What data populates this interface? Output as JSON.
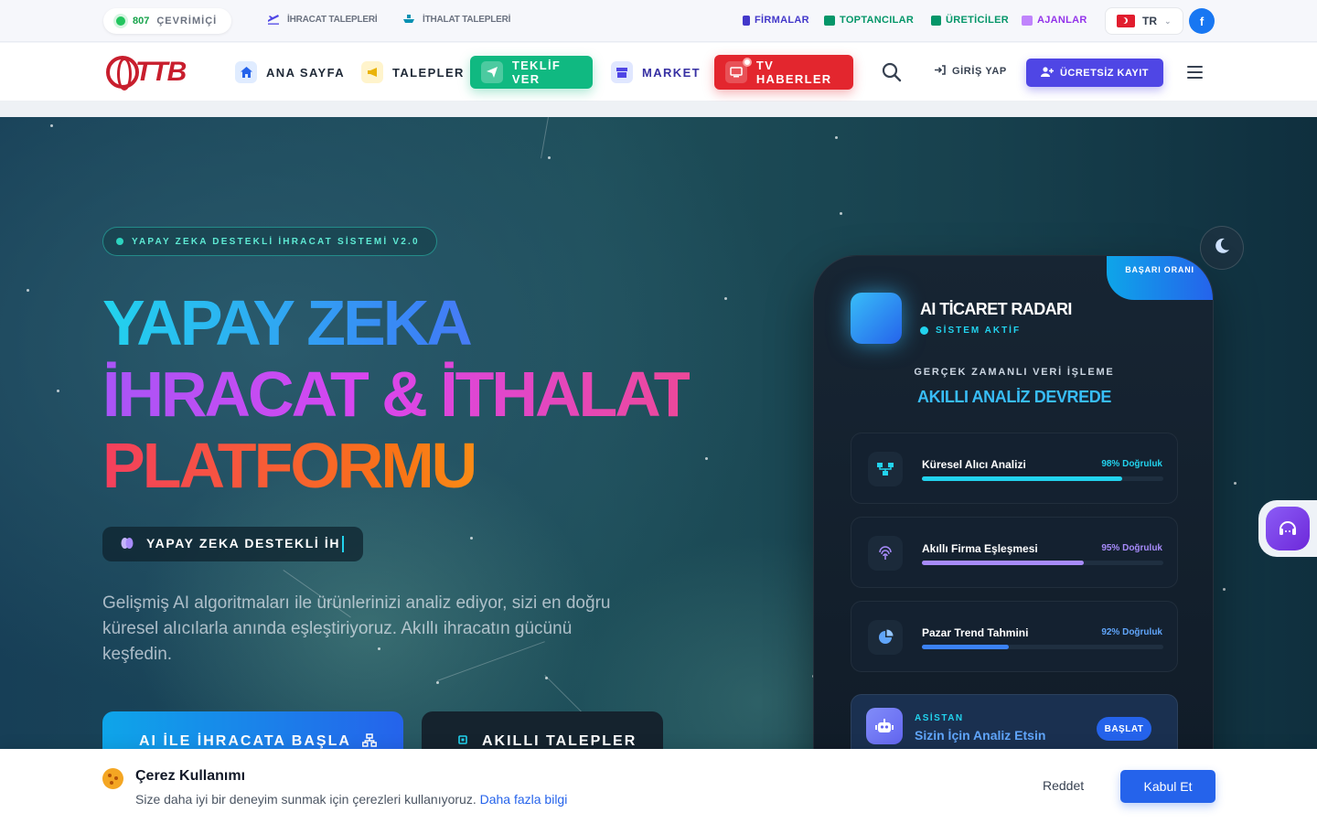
{
  "topbar": {
    "online_count": "807",
    "online_label": "ÇEVRİMİÇİ",
    "export_link": "İHRACAT TALEPLERİ",
    "import_link": "İTHALAT TALEPLERİ",
    "categories": [
      {
        "label": "FİRMALAR",
        "color": "#4338ca"
      },
      {
        "label": "TOPTANCILAR",
        "color": "#059669"
      },
      {
        "label": "ÜRETİCİLER",
        "color": "#059669"
      },
      {
        "label": "AJANLAR",
        "color": "#9333ea"
      }
    ],
    "language": "TR",
    "facebook_glyph": "f"
  },
  "nav": {
    "logo_text": "TTB",
    "home": "ANA SAYFA",
    "requests": "TALEPLER",
    "offer": "TEKLİF VER",
    "market": "MARKET",
    "tv": "TV HABERLER",
    "login": "GİRİŞ YAP",
    "register": "ÜCRETSİZ KAYIT"
  },
  "hero": {
    "badge": "YAPAY ZEKA DESTEKLİ İHRACAT SİSTEMİ V2.0",
    "title_line1": "YAPAY ZEKA",
    "title_line2": "İHRACAT & İTHALAT",
    "title_line3": "PLATFORMU",
    "typer_text": "YAPAY ZEKA DESTEKLİ İH",
    "description": "Gelişmiş AI algoritmaları ile ürünlerinizi analiz ediyor, sizi en doğru küresel alıcılarla anında eşleştiriyoruz. Akıllı ihracatın gücünü keşfedin.",
    "cta_primary": "AI İLE İHRACATA BAŞLA",
    "cta_secondary": "AKILLI TALEPLER"
  },
  "card": {
    "success_tag": "BAŞARI ORANI",
    "title": "AI TİCARET RADARI",
    "status": "SİSTEM AKTİF",
    "realtime_label": "GERÇEK ZAMANLI VERİ İŞLEME",
    "analysis_label": "AKILLI ANALİZ DEVREDE",
    "metrics": [
      {
        "label": "Küresel Alıcı Analizi",
        "percent": "98% Doğruluk",
        "value": 0.83,
        "color": "#22d3ee"
      },
      {
        "label": "Akıllı Firma Eşleşmesi",
        "percent": "95% Doğruluk",
        "value": 0.67,
        "color": "#a78bfa"
      },
      {
        "label": "Pazar Trend Tahmini",
        "percent": "92% Doğruluk",
        "value": 0.36,
        "color": "#3b82f6"
      }
    ],
    "assistant_label": "ASİSTAN",
    "assistant_title": "Sizin İçin Analiz Etsin",
    "assistant_button": "BAŞLAT"
  },
  "cookie": {
    "title": "Çerez Kullanımı",
    "text": "Size daha iyi bir deneyim sunmak için çerezleri kullanıyoruz.",
    "link": "Daha fazla bilgi",
    "reject": "Reddet",
    "accept": "Kabul Et"
  }
}
